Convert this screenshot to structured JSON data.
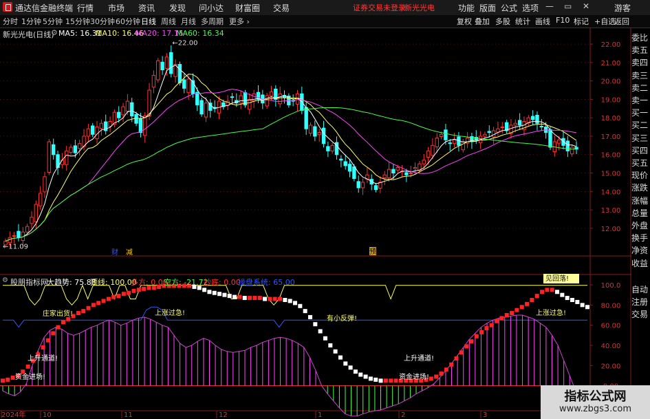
{
  "app": {
    "title": "通达信金融终端"
  },
  "menu": [
    "行情",
    "市场",
    "资讯",
    "发现",
    "问小达",
    "财富圈",
    "交易"
  ],
  "status_warning": "证券交易未登录",
  "stock_name_top": "新光光电",
  "right_menu": [
    "功能",
    "版面",
    "公式",
    "选项"
  ],
  "guest": "游客",
  "timeframes": [
    {
      "label": "分时",
      "active": false
    },
    {
      "label": "1分钟",
      "active": false
    },
    {
      "label": "5分钟",
      "active": false
    },
    {
      "label": "15分钟",
      "active": false
    },
    {
      "label": "30分钟",
      "active": false
    },
    {
      "label": "60分钟",
      "active": false
    },
    {
      "label": "日线",
      "active": true
    },
    {
      "label": "周线",
      "active": false
    },
    {
      "label": "月线",
      "active": false
    },
    {
      "label": "多周期",
      "active": false
    },
    {
      "label": "更多",
      "active": false
    }
  ],
  "right_toolbar": [
    "复权",
    "叠加",
    "多股",
    "统计",
    "画线",
    "F10",
    "标记",
    "+自选",
    "返回"
  ],
  "main_panel": {
    "stock_title": "新光光电(日线)",
    "ma": [
      {
        "label": "MA5: 16.31",
        "color": "#ffffff"
      },
      {
        "label": "MA10: 16.46",
        "color": "#ffff66"
      },
      {
        "label": "MA20: 17.15",
        "color": "#ff44ff"
      },
      {
        "label": "MA60: 16.34",
        "color": "#44ff44"
      }
    ],
    "max_label": "22.00",
    "min_label": "11.09",
    "markers": [
      "财",
      "减",
      "预"
    ]
  },
  "indicator_panel": {
    "name": "股朋指标网",
    "labels": [
      {
        "text": "大趋势: 75.88",
        "color": "#ffffff"
      },
      {
        "text": "顶线: 100.00",
        "color": "#ffff66"
      },
      {
        "text": "多方: 0.00",
        "color": "#ff3333"
      },
      {
        "text": "空方: -21.72",
        "color": "#44ff44"
      },
      {
        "text": "抄底: 0.00",
        "color": "#ff3333"
      },
      {
        "text": "操盘系统: 65.00",
        "color": "#3355ff"
      }
    ],
    "annotations": [
      "庄家出货!",
      "上涨过急!",
      "有小反弹!",
      "上涨过急!",
      "上升通道!",
      "上升通道!",
      "资金进场!",
      "资金进场!",
      "见回落!"
    ],
    "y_ticks": [
      "100.0",
      "80.00",
      "60.00",
      "40.00",
      "20.00",
      "0.00"
    ]
  },
  "chart_data": {
    "type": "candlestick",
    "title": "新光光电(日线)",
    "ylim": [
      10.8,
      22.6
    ],
    "y_ticks": [
      22,
      21,
      20,
      19,
      18,
      17,
      16,
      15,
      14,
      13,
      12
    ],
    "y_tick_labels": [
      "22.00",
      "21.00",
      "20.00",
      "19.00",
      "18.00",
      "17.00",
      "16.00",
      "15.00",
      "14.00",
      "13.00",
      "12.00"
    ],
    "x_tick_labels": [
      "2024年",
      "10",
      "11",
      "12",
      "1",
      "2",
      "3"
    ],
    "closes": [
      11.3,
      11.5,
      11.6,
      11.5,
      11.8,
      12.1,
      12.6,
      13.3,
      13.9,
      14.8,
      16.7,
      16.0,
      15.3,
      15.7,
      16.2,
      16.4,
      16.1,
      16.6,
      17.0,
      17.4,
      17.1,
      17.5,
      17.7,
      17.3,
      17.8,
      18.3,
      18.0,
      18.6,
      18.9,
      18.1,
      17.7,
      17.2,
      18.1,
      19.5,
      20.3,
      21.1,
      20.6,
      21.3,
      20.4,
      20.9,
      19.9,
      19.6,
      20.1,
      19.3,
      18.7,
      18.2,
      18.8,
      18.4,
      18.5,
      18.9,
      18.6,
      18.9,
      19.1,
      18.8,
      19.2,
      18.7,
      19.0,
      19.3,
      19.0,
      18.8,
      19.2,
      19.4,
      19.0,
      19.3,
      19.1,
      18.7,
      18.9,
      19.3,
      18.4,
      17.4,
      17.6,
      17.0,
      17.2,
      16.6,
      16.2,
      16.5,
      16.0,
      15.7,
      15.4,
      15.1,
      14.7,
      14.2,
      14.5,
      14.9,
      14.4,
      14.1,
      14.5,
      14.9,
      15.2,
      15.0,
      15.3,
      15.1,
      14.9,
      15.0,
      15.3,
      15.5,
      15.7,
      16.2,
      16.5,
      16.9,
      17.1,
      16.8,
      16.6,
      16.8,
      16.5,
      16.7,
      16.9,
      16.7,
      16.8,
      17.0,
      17.1,
      17.2,
      17.3,
      17.4,
      17.5,
      17.3,
      17.6,
      17.7,
      17.6,
      17.8,
      18.0,
      17.9,
      17.7,
      17.5,
      17.2,
      16.4,
      16.7,
      16.8,
      16.5,
      16.2,
      16.4,
      16.3
    ],
    "series": [
      {
        "name": "MA5",
        "color": "#ffffff",
        "value": 16.31
      },
      {
        "name": "MA10",
        "color": "#ffff66",
        "value": 16.46
      },
      {
        "name": "MA20",
        "color": "#ff44ff",
        "value": 17.15
      },
      {
        "name": "MA60",
        "color": "#44ff44",
        "value": 16.34
      }
    ],
    "indicator": {
      "ylim": [
        -20,
        100
      ],
      "trend": [
        5,
        6,
        8,
        10,
        14,
        19,
        25,
        31,
        38,
        45,
        52,
        58,
        63,
        66,
        69,
        72,
        74,
        77,
        80,
        82,
        84,
        86,
        88,
        89,
        91,
        92,
        94,
        95,
        96,
        97,
        97,
        98,
        99,
        99,
        99,
        99,
        99,
        99,
        98,
        97,
        95,
        93,
        92,
        91,
        90,
        89,
        88,
        88,
        87,
        87,
        87,
        87,
        86,
        86,
        86,
        86,
        85,
        84,
        82,
        79,
        74,
        68,
        61,
        54,
        47,
        40,
        34,
        28,
        22,
        18,
        14,
        11,
        9,
        7,
        6,
        5,
        5,
        5,
        5,
        5,
        5,
        5,
        5,
        5,
        6,
        7,
        9,
        12,
        16,
        21,
        27,
        33,
        39,
        44,
        49,
        53,
        57,
        60,
        64,
        67,
        70,
        72,
        75,
        78,
        81,
        85,
        89,
        93,
        95,
        95,
        93,
        90,
        87,
        85,
        83,
        80,
        78
      ],
      "histogram": [
        -5,
        -8,
        -10,
        -6,
        2,
        20,
        35,
        48,
        55,
        58,
        56,
        52,
        50,
        52,
        55,
        58,
        60,
        63,
        65,
        63,
        60,
        62,
        65,
        67,
        68,
        66,
        63,
        60,
        58,
        50,
        42,
        38,
        40,
        44,
        47,
        45,
        40,
        36,
        34,
        33,
        34,
        35,
        38,
        40,
        43,
        45,
        47,
        48,
        47,
        45,
        42,
        38,
        28,
        15,
        0,
        -8,
        -15,
        -22,
        -28,
        -30,
        -30,
        -28,
        -26,
        -25,
        -24,
        -22,
        -20,
        -18,
        -15,
        -12,
        -8,
        -5,
        -2,
        2,
        8,
        15,
        22,
        30,
        38,
        46,
        52,
        58,
        62,
        65,
        67,
        68,
        69,
        70,
        70,
        68,
        66,
        62,
        58,
        50,
        40,
        25,
        10,
        -5,
        -15,
        -20
      ]
    }
  }
}
